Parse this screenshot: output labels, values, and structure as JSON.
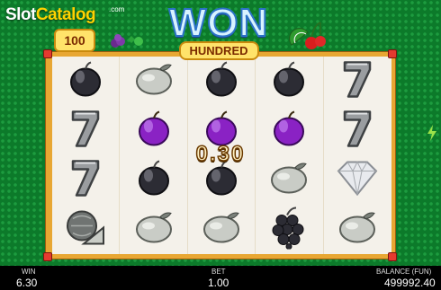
{
  "watermark": {
    "brand_a": "Slot",
    "brand_b": "Catalog",
    "suffix": ".com"
  },
  "logo": {
    "small_badge": "100",
    "title": "WON",
    "subtitle": "HUNDRED"
  },
  "reels": [
    [
      "plum",
      "seven",
      "seven",
      "watermelon"
    ],
    [
      "lemon",
      "plum",
      "plum",
      "lemon"
    ],
    [
      "plum",
      "plum",
      "plum",
      "lemon"
    ],
    [
      "plum",
      "plum",
      "lemon",
      "grapes"
    ],
    [
      "seven",
      "seven",
      "diamond",
      "lemon"
    ]
  ],
  "win_line": {
    "row": 1,
    "amount": "0.30"
  },
  "footer": {
    "win_label": "WIN",
    "win_value": "6.30",
    "bet_label": "BET",
    "bet_value": "1.00",
    "balance_label": "BALANCE (FUN)",
    "balance_value": "499992.40"
  },
  "colors": {
    "background": "#0c7a2a",
    "frame": "#e8a733",
    "highlight": "#1a6d18",
    "highlight_border": "#a9e044"
  }
}
